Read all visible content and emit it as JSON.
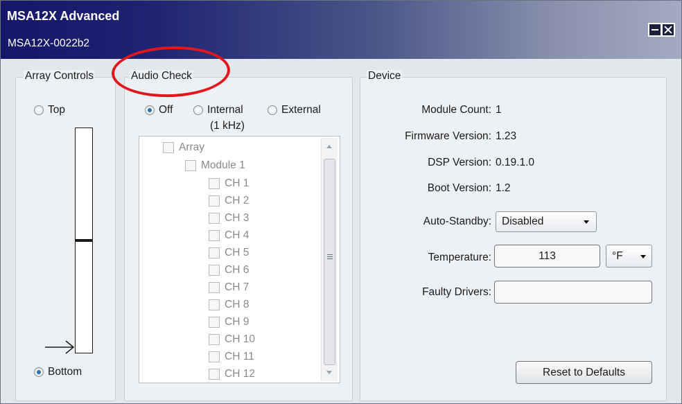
{
  "window": {
    "title": "MSA12X Advanced",
    "subtitle": "MSA12X-0022b2"
  },
  "array_controls": {
    "label": "Array Controls",
    "top_label": "Top",
    "bottom_label": "Bottom",
    "selected": "Bottom"
  },
  "audio_check": {
    "label": "Audio Check",
    "options": [
      {
        "label": "Off",
        "selected": true
      },
      {
        "label": "Internal",
        "sublabel": "(1 kHz)",
        "selected": false
      },
      {
        "label": "External",
        "selected": false
      }
    ],
    "tree": {
      "root": "Array",
      "module": "Module 1",
      "channels": [
        "CH 1",
        "CH 2",
        "CH 3",
        "CH 4",
        "CH 5",
        "CH 6",
        "CH 7",
        "CH 8",
        "CH 9",
        "CH 10",
        "CH 11",
        "CH 12"
      ]
    }
  },
  "device": {
    "label": "Device",
    "module_count_label": "Module Count:",
    "module_count": "1",
    "firmware_label": "Firmware Version:",
    "firmware": "1.23",
    "dsp_label": "DSP Version:",
    "dsp": "0.19.1.0",
    "boot_label": "Boot Version:",
    "boot": "1.2",
    "standby_label": "Auto-Standby:",
    "standby": "Disabled",
    "temperature_label": "Temperature:",
    "temperature": "113",
    "temp_unit": "°F",
    "faulty_label": "Faulty Drivers:",
    "faulty": "",
    "reset_label": "Reset to Defaults"
  },
  "colors": {
    "highlight": "#e3161e",
    "radio_selected": "#2a6fb4",
    "titlebar_dark": "#16166a"
  }
}
